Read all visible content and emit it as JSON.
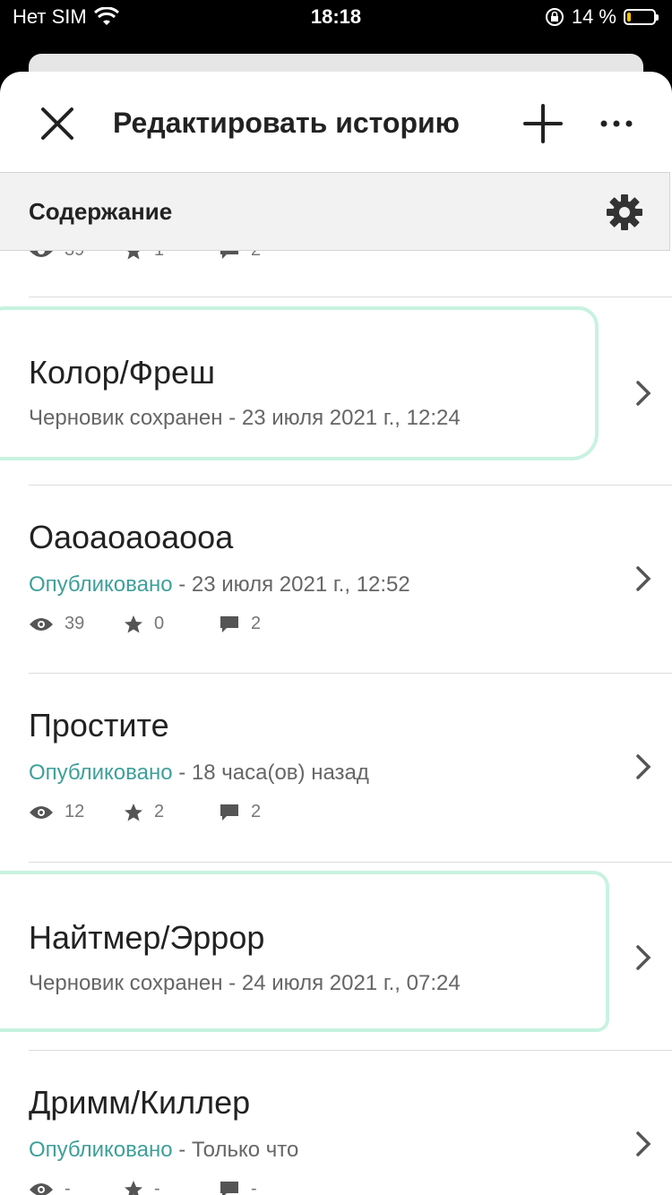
{
  "status": {
    "carrier": "Нет SIM",
    "time": "18:18",
    "battery": "14 %",
    "battery_level": 0.14,
    "battery_color": "#f5c400"
  },
  "header": {
    "title": "Редактировать историю"
  },
  "section": {
    "label": "Содержание"
  },
  "partial_stats": {
    "views": "39",
    "stars": "1",
    "comments": "2"
  },
  "items": [
    {
      "name": "Колор/Фреш",
      "status": "",
      "status_detail": "Черновик сохранен - 23 июля 2021 г., 12:24"
    },
    {
      "name": "Оаоаоаоаооа",
      "status": "Опубликовано",
      "status_detail": " - 23 июля 2021 г., 12:52",
      "views": "39",
      "stars": "0",
      "comments": "2"
    },
    {
      "name": "Простите",
      "status": "Опубликовано",
      "status_detail": " - 18 часа(ов) назад",
      "views": "12",
      "stars": "2",
      "comments": "2"
    },
    {
      "name": "Найтмер/Эррор",
      "status": "",
      "status_detail": "Черновик сохранен - 24 июля 2021 г., 07:24"
    },
    {
      "name": "Дримм/Киллер",
      "status": "Опубликовано",
      "status_detail": " - Только что",
      "views": "-",
      "stars": "-",
      "comments": "-"
    }
  ],
  "colors": {
    "published": "#3f9f9a",
    "highlight": "#c8f2e0"
  }
}
